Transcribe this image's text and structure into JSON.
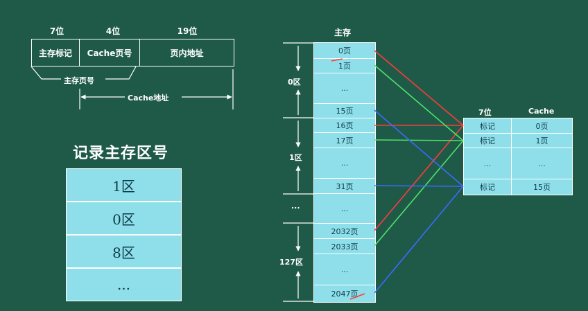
{
  "address_format": {
    "bits": [
      "7位",
      "4位",
      "19位"
    ],
    "fields": [
      "主存标记",
      "Cache页号",
      "页内地址"
    ],
    "main_page_label": "主存页号",
    "cache_addr_label": "Cache地址"
  },
  "region_record": {
    "title": "记录主存区号",
    "rows": [
      "1区",
      "0区",
      "8区",
      "..."
    ]
  },
  "main_memory": {
    "title": "主存",
    "pages": [
      "0页",
      "1页",
      "...",
      "15页",
      "16页",
      "17页",
      "...",
      "31页",
      "...",
      "2032页",
      "2033页",
      "...",
      "2047页"
    ],
    "zones": [
      "0区",
      "1区",
      "...",
      "127区"
    ]
  },
  "cache": {
    "head_bits": "7位",
    "head_title": "Cache",
    "rows": [
      {
        "tag": "标记",
        "page": "0页"
      },
      {
        "tag": "标记",
        "page": "1页"
      },
      {
        "tag": "...",
        "page": "..."
      },
      {
        "tag": "标记",
        "page": "15页"
      }
    ]
  },
  "colors": {
    "board": "#1f5a48",
    "cell": "#8fdfea",
    "red": "#ff3b3b",
    "green": "#4fe36a",
    "blue": "#3b6bff"
  }
}
